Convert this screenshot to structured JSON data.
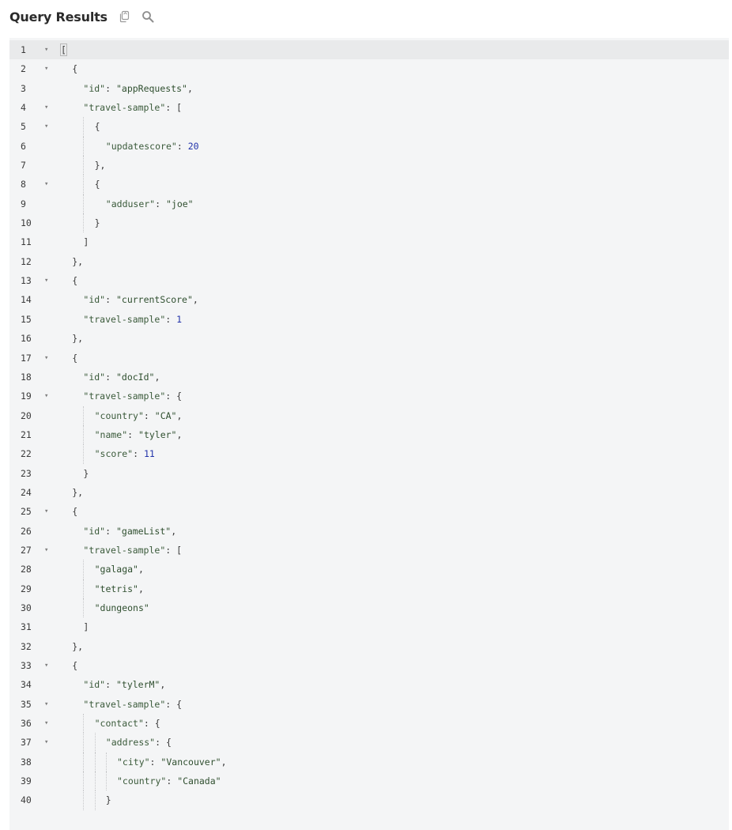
{
  "header": {
    "title": "Query Results",
    "copy_icon": "copy-icon",
    "search_icon": "search-icon"
  },
  "colors": {
    "editor_bg": "#f4f5f6",
    "active_line_bg": "#e9eaeb",
    "number": "#2233aa",
    "string": "#2f4f2f"
  },
  "editor": {
    "lines": [
      {
        "n": "1",
        "fold": true,
        "indent": 0,
        "guides": [],
        "text": "["
      },
      {
        "n": "2",
        "fold": true,
        "indent": 1,
        "guides": [],
        "text": "{"
      },
      {
        "n": "3",
        "fold": false,
        "indent": 2,
        "guides": [],
        "text": "\"id\": \"appRequests\","
      },
      {
        "n": "4",
        "fold": true,
        "indent": 2,
        "guides": [],
        "text": "\"travel-sample\": ["
      },
      {
        "n": "5",
        "fold": true,
        "indent": 3,
        "guides": [
          2
        ],
        "text": "{"
      },
      {
        "n": "6",
        "fold": false,
        "indent": 4,
        "guides": [
          2
        ],
        "text": "\"updatescore\": 20"
      },
      {
        "n": "7",
        "fold": false,
        "indent": 3,
        "guides": [
          2
        ],
        "text": "},"
      },
      {
        "n": "8",
        "fold": true,
        "indent": 3,
        "guides": [
          2
        ],
        "text": "{"
      },
      {
        "n": "9",
        "fold": false,
        "indent": 4,
        "guides": [
          2
        ],
        "text": "\"adduser\": \"joe\""
      },
      {
        "n": "10",
        "fold": false,
        "indent": 3,
        "guides": [
          2
        ],
        "text": "}"
      },
      {
        "n": "11",
        "fold": false,
        "indent": 2,
        "guides": [],
        "text": "]"
      },
      {
        "n": "12",
        "fold": false,
        "indent": 1,
        "guides": [],
        "text": "},"
      },
      {
        "n": "13",
        "fold": true,
        "indent": 1,
        "guides": [],
        "text": "{"
      },
      {
        "n": "14",
        "fold": false,
        "indent": 2,
        "guides": [],
        "text": "\"id\": \"currentScore\","
      },
      {
        "n": "15",
        "fold": false,
        "indent": 2,
        "guides": [],
        "text": "\"travel-sample\": 1"
      },
      {
        "n": "16",
        "fold": false,
        "indent": 1,
        "guides": [],
        "text": "},"
      },
      {
        "n": "17",
        "fold": true,
        "indent": 1,
        "guides": [],
        "text": "{"
      },
      {
        "n": "18",
        "fold": false,
        "indent": 2,
        "guides": [],
        "text": "\"id\": \"docId\","
      },
      {
        "n": "19",
        "fold": true,
        "indent": 2,
        "guides": [],
        "text": "\"travel-sample\": {"
      },
      {
        "n": "20",
        "fold": false,
        "indent": 3,
        "guides": [
          2
        ],
        "text": "\"country\": \"CA\","
      },
      {
        "n": "21",
        "fold": false,
        "indent": 3,
        "guides": [
          2
        ],
        "text": "\"name\": \"tyler\","
      },
      {
        "n": "22",
        "fold": false,
        "indent": 3,
        "guides": [
          2
        ],
        "text": "\"score\": 11"
      },
      {
        "n": "23",
        "fold": false,
        "indent": 2,
        "guides": [],
        "text": "}"
      },
      {
        "n": "24",
        "fold": false,
        "indent": 1,
        "guides": [],
        "text": "},"
      },
      {
        "n": "25",
        "fold": true,
        "indent": 1,
        "guides": [],
        "text": "{"
      },
      {
        "n": "26",
        "fold": false,
        "indent": 2,
        "guides": [],
        "text": "\"id\": \"gameList\","
      },
      {
        "n": "27",
        "fold": true,
        "indent": 2,
        "guides": [],
        "text": "\"travel-sample\": ["
      },
      {
        "n": "28",
        "fold": false,
        "indent": 3,
        "guides": [
          2
        ],
        "text": "\"galaga\","
      },
      {
        "n": "29",
        "fold": false,
        "indent": 3,
        "guides": [
          2
        ],
        "text": "\"tetris\","
      },
      {
        "n": "30",
        "fold": false,
        "indent": 3,
        "guides": [
          2
        ],
        "text": "\"dungeons\""
      },
      {
        "n": "31",
        "fold": false,
        "indent": 2,
        "guides": [],
        "text": "]"
      },
      {
        "n": "32",
        "fold": false,
        "indent": 1,
        "guides": [],
        "text": "},"
      },
      {
        "n": "33",
        "fold": true,
        "indent": 1,
        "guides": [],
        "text": "{"
      },
      {
        "n": "34",
        "fold": false,
        "indent": 2,
        "guides": [],
        "text": "\"id\": \"tylerM\","
      },
      {
        "n": "35",
        "fold": true,
        "indent": 2,
        "guides": [],
        "text": "\"travel-sample\": {"
      },
      {
        "n": "36",
        "fold": true,
        "indent": 3,
        "guides": [
          2
        ],
        "text": "\"contact\": {"
      },
      {
        "n": "37",
        "fold": true,
        "indent": 4,
        "guides": [
          2,
          3
        ],
        "text": "\"address\": {"
      },
      {
        "n": "38",
        "fold": false,
        "indent": 5,
        "guides": [
          2,
          3,
          4
        ],
        "text": "\"city\": \"Vancouver\","
      },
      {
        "n": "39",
        "fold": false,
        "indent": 5,
        "guides": [
          2,
          3,
          4
        ],
        "text": "\"country\": \"Canada\""
      },
      {
        "n": "40",
        "fold": false,
        "indent": 4,
        "guides": [
          2,
          3
        ],
        "text": "}"
      }
    ]
  }
}
